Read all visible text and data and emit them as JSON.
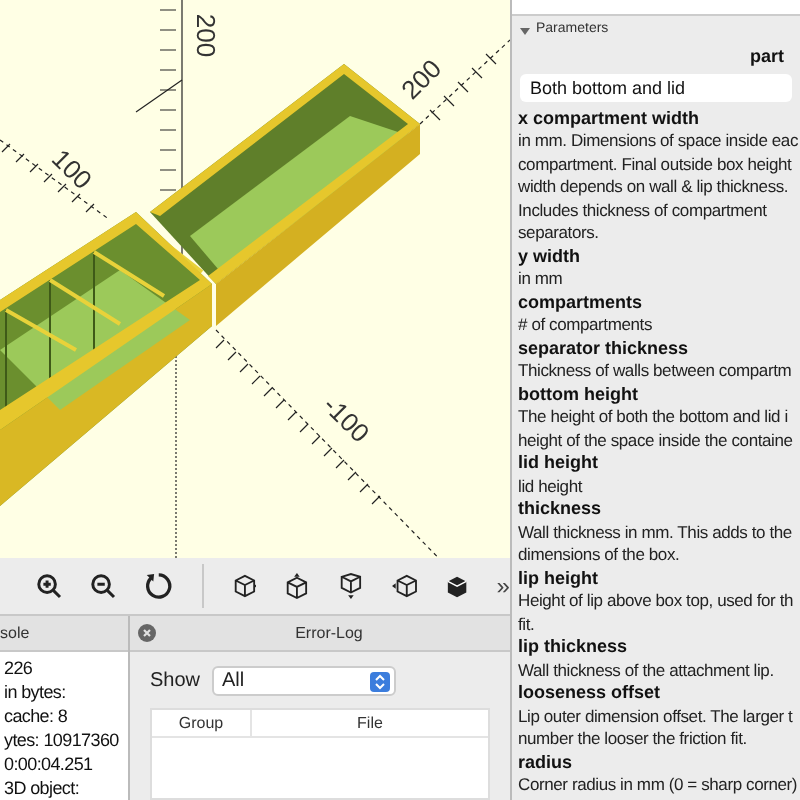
{
  "viewport": {
    "axis_labels": [
      {
        "text": "200",
        "kind": "vertical"
      },
      {
        "text": "200",
        "kind": "diagonal"
      },
      {
        "text": "100",
        "kind": "back"
      },
      {
        "text": "-100",
        "kind": "front"
      }
    ]
  },
  "toolbar": {
    "more": "»"
  },
  "parameters": {
    "title": "Parameters",
    "expanded": true,
    "group": "part",
    "dropdown": "Both bottom and lid",
    "items": [
      {
        "name": "x compartment width",
        "description": [
          "in mm. Dimensions of space inside eac",
          "compartment. Final outside box height",
          "width depends on wall & lip thickness.",
          "Includes thickness of compartment",
          "separators."
        ]
      },
      {
        "name": "y width",
        "description": [
          "in mm"
        ]
      },
      {
        "name": "compartments",
        "description": [
          "# of compartments"
        ]
      },
      {
        "name": "separator thickness",
        "description": [
          "Thickness of walls between compartm"
        ]
      },
      {
        "name": "bottom height",
        "description": [
          "The height of both the bottom and lid i",
          "height of the space inside the containe"
        ]
      },
      {
        "name": "lid height",
        "description": [
          "lid height"
        ]
      },
      {
        "name": "thickness",
        "description": [
          "Wall thickness in mm. This adds to the",
          "dimensions of the box."
        ]
      },
      {
        "name": "lip height",
        "description": [
          "Height of lip above box top, used for th",
          "fit."
        ]
      },
      {
        "name": "lip thickness",
        "description": [
          "Wall thickness of the attachment lip."
        ]
      },
      {
        "name": "looseness offset",
        "description": [
          "Lip outer dimension offset. The larger t",
          "number the looser the friction fit."
        ]
      },
      {
        "name": "radius",
        "description": [
          "Corner radius in mm (0 = sharp corner)"
        ]
      }
    ]
  },
  "console": {
    "title": "sole",
    "lines": [
      "226",
      "in bytes:",
      "cache: 8",
      "ytes: 10917360",
      "0:00:04.251",
      "3D object:"
    ]
  },
  "error_log": {
    "title": "Error-Log",
    "show_label": "Show",
    "filter": "All",
    "columns": [
      "Group",
      "File"
    ]
  }
}
